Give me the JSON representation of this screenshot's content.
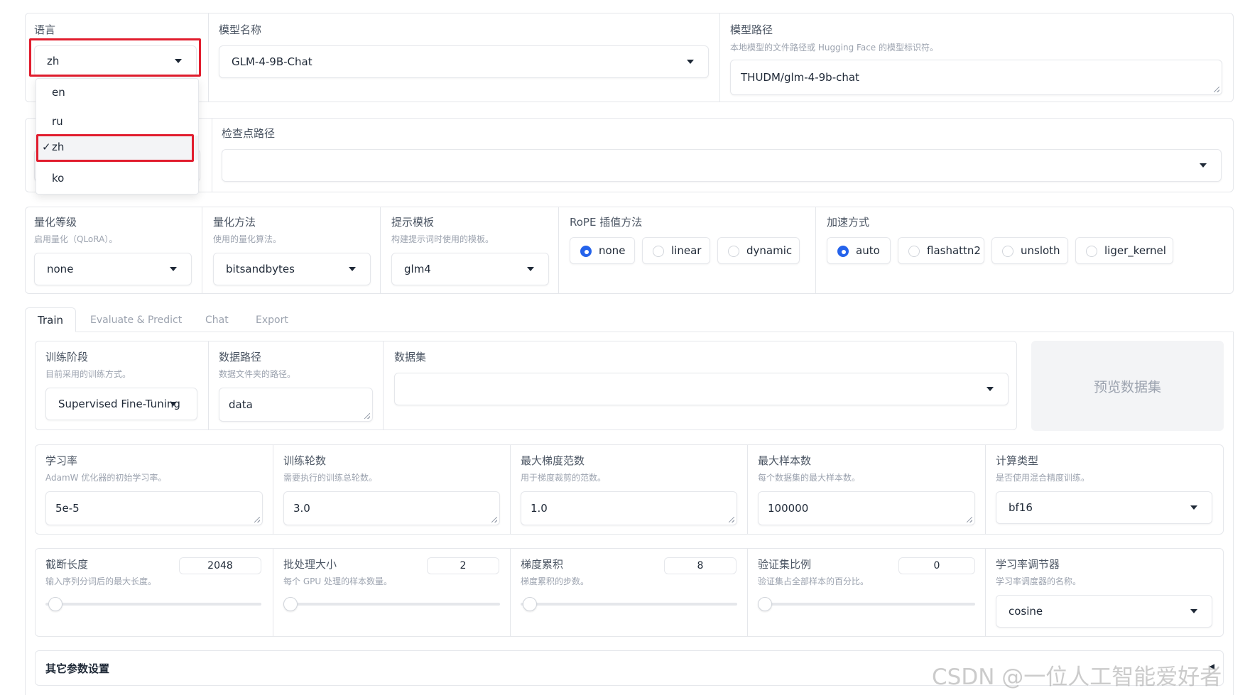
{
  "top": {
    "language": {
      "label": "语言",
      "value": "zh",
      "options": [
        "en",
        "ru",
        "zh",
        "ko"
      ],
      "selected": "zh",
      "check_glyph": "✓"
    },
    "model_name": {
      "label": "模型名称",
      "value": "GLM-4-9B-Chat"
    },
    "model_path": {
      "label": "模型路径",
      "info": "本地模型的文件路径或 Hugging Face 的模型标识符。",
      "value": "THUDM/glm-4-9b-chat"
    }
  },
  "row2": {
    "checkpoint": {
      "label": "检查点路径",
      "value": ""
    }
  },
  "row3": {
    "quant_bit": {
      "label": "量化等级",
      "info": "启用量化（QLoRA）。",
      "value": "none"
    },
    "quant_method": {
      "label": "量化方法",
      "info": "使用的量化算法。",
      "value": "bitsandbytes"
    },
    "template": {
      "label": "提示模板",
      "info": "构建提示词时使用的模板。",
      "value": "glm4"
    },
    "rope": {
      "label": "RoPE 插值方法",
      "options": [
        "none",
        "linear",
        "dynamic"
      ],
      "selected": "none"
    },
    "booster": {
      "label": "加速方式",
      "options": [
        "auto",
        "flashattn2",
        "unsloth",
        "liger_kernel"
      ],
      "selected": "auto"
    }
  },
  "tabs": [
    "Train",
    "Evaluate & Predict",
    "Chat",
    "Export"
  ],
  "train": {
    "stage": {
      "label": "训练阶段",
      "info": "目前采用的训练方式。",
      "value": "Supervised Fine-Tuning"
    },
    "dataset_dir": {
      "label": "数据路径",
      "info": "数据文件夹的路径。",
      "value": "data"
    },
    "dataset": {
      "label": "数据集",
      "value": ""
    },
    "preview_button": "预览数据集",
    "learning_rate": {
      "label": "学习率",
      "info": "AdamW 优化器的初始学习率。",
      "value": "5e-5"
    },
    "epochs": {
      "label": "训练轮数",
      "info": "需要执行的训练总轮数。",
      "value": "3.0"
    },
    "max_grad_norm": {
      "label": "最大梯度范数",
      "info": "用于梯度裁剪的范数。",
      "value": "1.0"
    },
    "max_samples": {
      "label": "最大样本数",
      "info": "每个数据集的最大样本数。",
      "value": "100000"
    },
    "compute_type": {
      "label": "计算类型",
      "info": "是否使用混合精度训练。",
      "value": "bf16"
    },
    "cutoff_len": {
      "label": "截断长度",
      "info": "输入序列分词后的最大长度。",
      "value": "2048",
      "fraction": 0.01
    },
    "batch_size": {
      "label": "批处理大小",
      "info": "每个 GPU 处理的样本数量。",
      "value": "2",
      "fraction": 0.0
    },
    "grad_accum": {
      "label": "梯度累积",
      "info": "梯度累积的步数。",
      "value": "8",
      "fraction": 0.01
    },
    "val_size": {
      "label": "验证集比例",
      "info": "验证集占全部样本的百分比。",
      "value": "0",
      "fraction": 0.0
    },
    "lr_scheduler": {
      "label": "学习率调节器",
      "info": "学习率调度器的名称。",
      "value": "cosine"
    },
    "extra": {
      "label": "其它参数设置",
      "arrow": "◂"
    }
  },
  "watermark": "CSDN @一位人工智能爱好者",
  "colors": {
    "accent": "#2563eb",
    "highlight": "#e11d2e"
  }
}
